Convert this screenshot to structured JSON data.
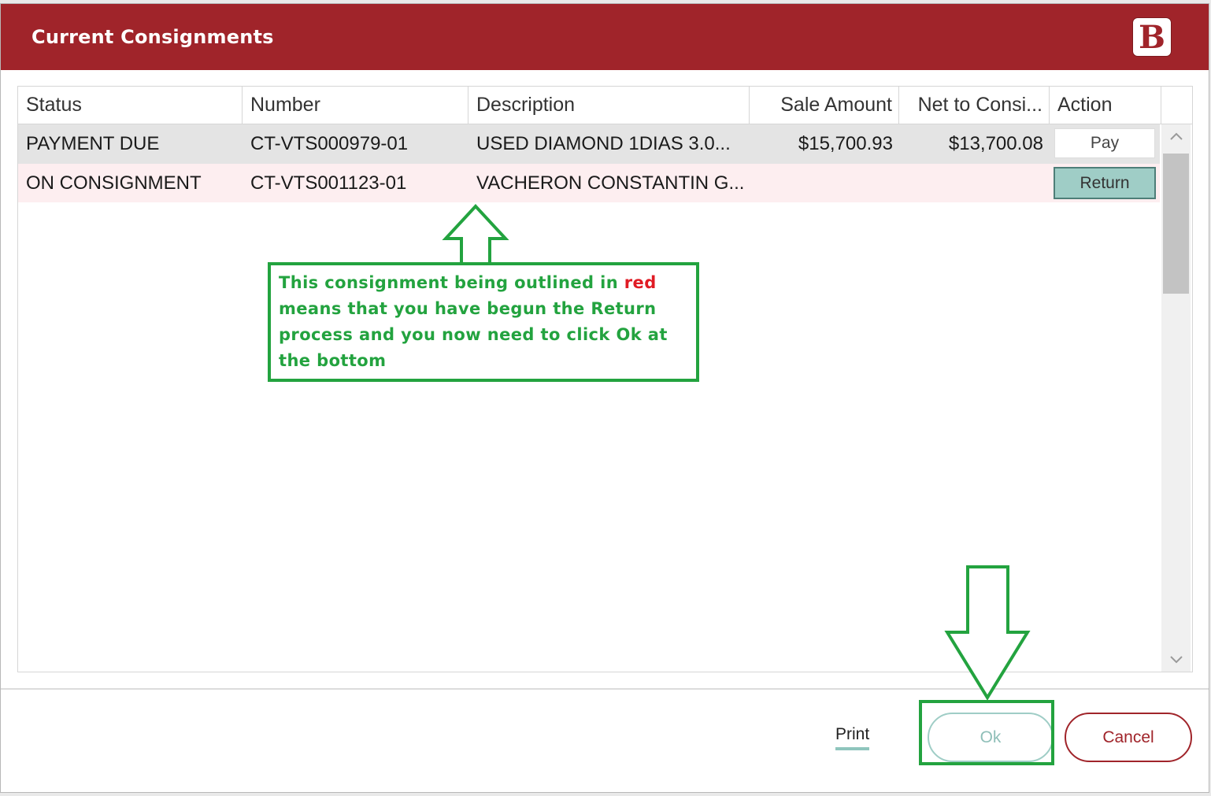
{
  "window": {
    "title": "Current Consignments",
    "logo_text": "B"
  },
  "table": {
    "headers": [
      "Status",
      "Number",
      "Description",
      "Sale Amount",
      "Net to Consi...",
      "Action"
    ],
    "rows": [
      {
        "status": "PAYMENT DUE",
        "number": "CT-VTS000979-01",
        "description": "USED DIAMOND 1DIAS 3.0...",
        "sale_amount": "$15,700.93",
        "net": "$13,700.08",
        "action": "Pay"
      },
      {
        "status": "ON CONSIGNMENT",
        "number": "CT-VTS001123-01",
        "description": "VACHERON CONSTANTIN G...",
        "sale_amount": "",
        "net": "",
        "action": "Return"
      }
    ]
  },
  "footer": {
    "print_label": "Print",
    "ok_label": "Ok",
    "cancel_label": "Cancel"
  },
  "annotation": {
    "line1_prefix": "This consignment being outlined in ",
    "line1_highlight": "red",
    "line2": "means that you have begun the Return",
    "line3": "process and you now need to click Ok at",
    "line4": "the bottom"
  },
  "colors": {
    "title_bar": "#a0242a",
    "annotation_green": "#23a33f",
    "annotation_red": "#e01b24",
    "return_button": "#9fcdc6",
    "row_pending_return": "#fdeef0"
  },
  "icons": {
    "scroll_up": "chevron-up-icon",
    "scroll_down": "chevron-down-icon"
  }
}
